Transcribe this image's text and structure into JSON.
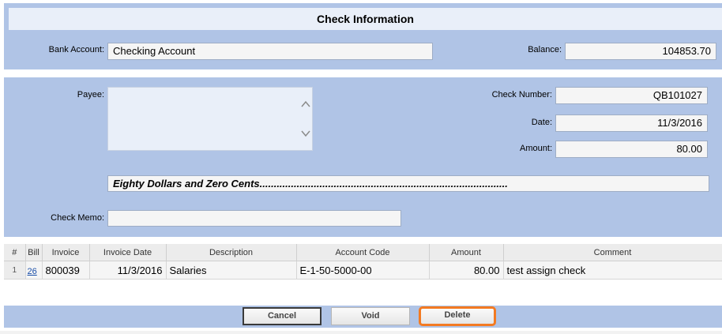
{
  "section_title": "Check Information",
  "bank_account": {
    "label": "Bank Account:",
    "value": "Checking Account"
  },
  "balance": {
    "label": "Balance:",
    "value": "104853.70"
  },
  "payee": {
    "label": "Payee:",
    "value": ""
  },
  "check_number": {
    "label": "Check Number:",
    "value": "QB101027"
  },
  "date": {
    "label": "Date:",
    "value": "11/3/2016"
  },
  "amount": {
    "label": "Amount:",
    "value": "80.00"
  },
  "amount_words": "Eighty Dollars and Zero Cents.......................................................................................",
  "check_memo": {
    "label": "Check Memo:",
    "value": ""
  },
  "grid": {
    "columns": [
      "#",
      "Bill",
      "Invoice",
      "Invoice Date",
      "Description",
      "Account Code",
      "Amount",
      "Comment"
    ],
    "rows": [
      {
        "num": "1",
        "bill": "26",
        "invoice": "800039",
        "invoice_date": "11/3/2016",
        "description": "Salaries",
        "account_code": "E-1-50-5000-00",
        "amount": "80.00",
        "comment": "test assign check"
      }
    ]
  },
  "buttons": {
    "cancel": "Cancel",
    "void": "Void",
    "delete": "Delete"
  },
  "colors": {
    "panel": "#b0c4e6",
    "title_bar": "#e9eff9",
    "highlight": "#f37a22",
    "link": "#1b4fa8"
  }
}
